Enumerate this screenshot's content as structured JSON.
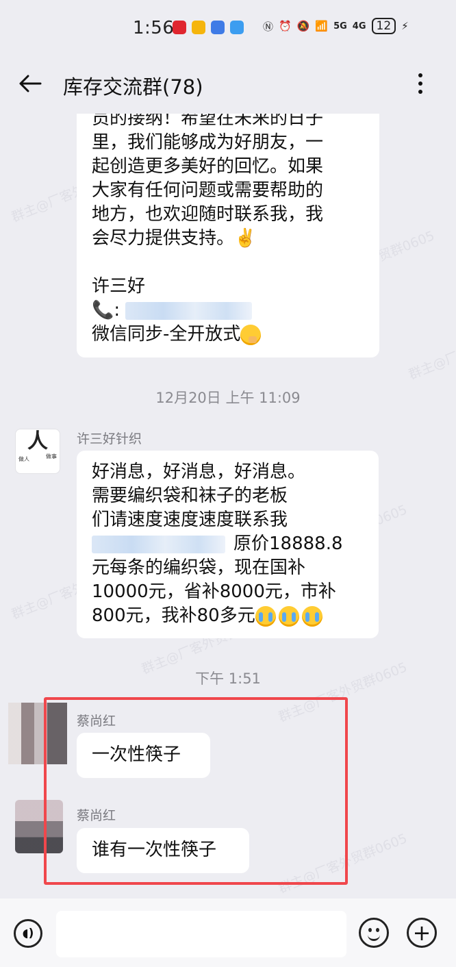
{
  "status_bar": {
    "time": "1:56",
    "network_1": "5G",
    "network_2": "4G",
    "battery": "12"
  },
  "header": {
    "title": "库存交流群(78)"
  },
  "messages": {
    "msg1": {
      "lines": [
        "员的接纳！希望在未来的日子",
        "里，我们能够成为好朋友，一",
        "起创造更多美好的回忆。如果",
        "大家有任何问题或需要帮助的",
        "地方，也欢迎随时联系我，我",
        "会尽力提供支持。✌️",
        "",
        "许三好",
        "📞:",
        "微信同步-全开放式"
      ]
    },
    "timestamp1": "12月20日 上午 11:09",
    "msg2": {
      "sender": "许三好针织",
      "avatar_char": "人",
      "avatar_left_text": "做人",
      "avatar_right_text": "做事",
      "lines": [
        "好消息，好消息，好消息。",
        "需要编织袋和袜子的老板",
        "们请速度速度速度联系我",
        "原价18888.8",
        "元每条的编织袋，现在国补",
        "10000元，省补8000元，市补",
        "800元，我补80多元"
      ]
    },
    "timestamp2": "下午 1:51",
    "msg3": {
      "sender": "蔡尚红",
      "text": "一次性筷子"
    },
    "msg4": {
      "sender": "蔡尚红",
      "text": "谁有一次性筷子"
    }
  },
  "watermarks": [
    "群主@厂客外贸群0605"
  ],
  "icons": {
    "back": "arrow-left-icon",
    "more": "more-vertical-icon",
    "voice": "voice-icon",
    "emoji": "emoji-icon",
    "plus": "plus-icon"
  },
  "colors": {
    "background": "#ededf2",
    "bubble": "#ffffff",
    "highlight": "#f0474c",
    "text_secondary": "#8a8a90"
  }
}
